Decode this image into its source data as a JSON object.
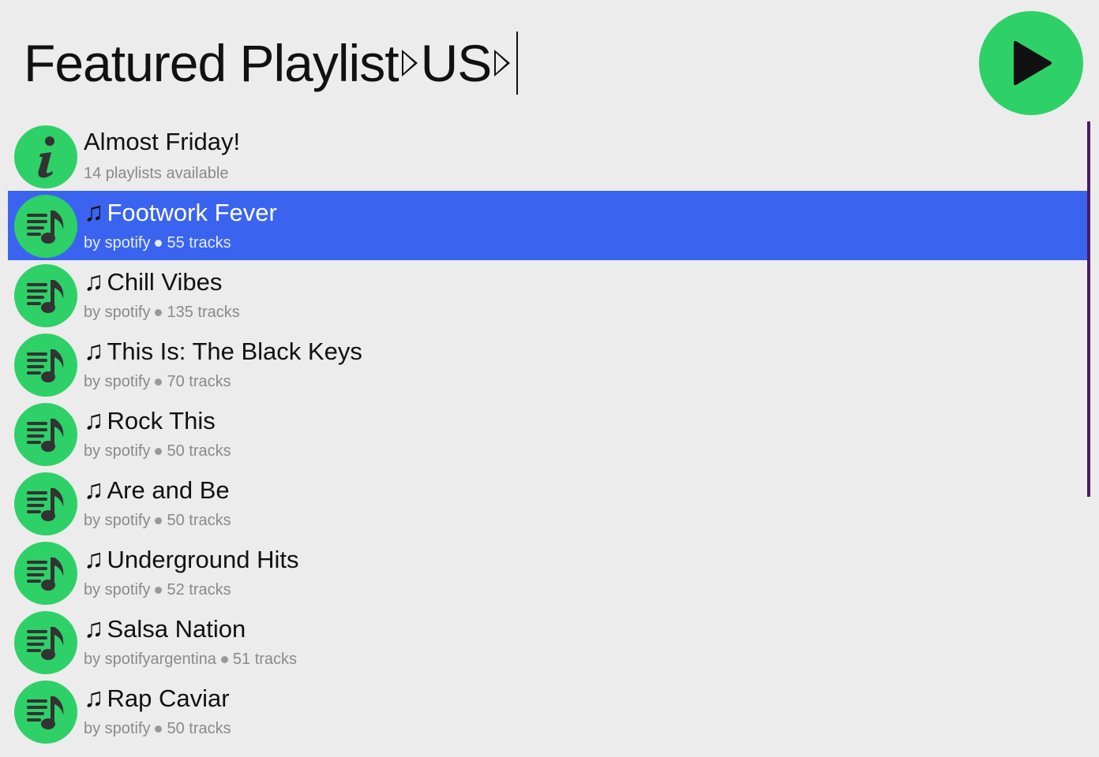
{
  "query": {
    "parts": [
      "Featured Playlist",
      "US"
    ]
  },
  "colors": {
    "accent": "#2ed068",
    "selection": "#3a64ef"
  },
  "info": {
    "title": "Almost Friday!",
    "subtitle": "14 playlists available"
  },
  "playlists": [
    {
      "title": "Footwork Fever",
      "owner": "by spotify",
      "tracks": "55 tracks",
      "selected": true
    },
    {
      "title": "Chill Vibes",
      "owner": "by spotify",
      "tracks": "135 tracks"
    },
    {
      "title": "This Is: The Black Keys",
      "owner": "by spotify",
      "tracks": "70 tracks"
    },
    {
      "title": "Rock This",
      "owner": "by spotify",
      "tracks": "50 tracks"
    },
    {
      "title": "Are and Be",
      "owner": "by spotify",
      "tracks": "50 tracks"
    },
    {
      "title": "Underground Hits",
      "owner": "by spotify",
      "tracks": "52 tracks"
    },
    {
      "title": "Salsa Nation",
      "owner": "by spotifyargentina",
      "tracks": "51 tracks"
    },
    {
      "title": "Rap Caviar",
      "owner": "by spotify",
      "tracks": "50 tracks"
    }
  ]
}
